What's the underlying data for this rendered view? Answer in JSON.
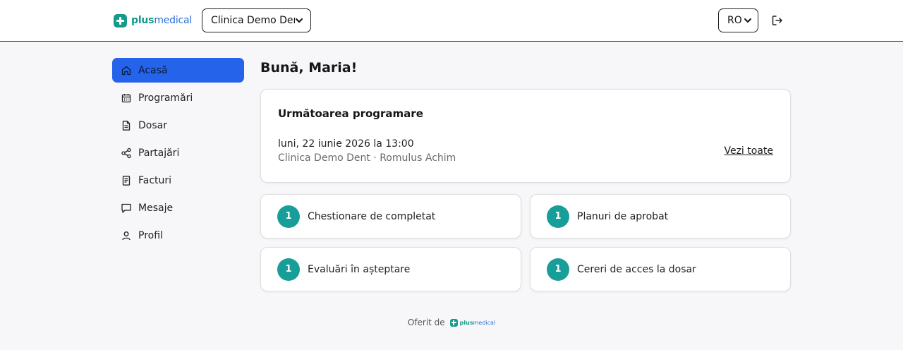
{
  "brand": {
    "word_bold": "plus",
    "word_light": "medical",
    "color_mark": "#159a8c",
    "color_bold": "#159a8c",
    "color_light": "#2b6fd6"
  },
  "header": {
    "clinic_select": "Clinica Demo Dent",
    "language_select": "RO"
  },
  "sidebar": {
    "items": [
      {
        "label": "Acasă",
        "icon": "home-icon",
        "active": true
      },
      {
        "label": "Programări",
        "icon": "calendar-icon",
        "active": false
      },
      {
        "label": "Dosar",
        "icon": "document-icon",
        "active": false
      },
      {
        "label": "Partajări",
        "icon": "share-icon",
        "active": false
      },
      {
        "label": "Facturi",
        "icon": "invoice-icon",
        "active": false
      },
      {
        "label": "Mesaje",
        "icon": "message-icon",
        "active": false
      },
      {
        "label": "Profil",
        "icon": "user-icon",
        "active": false
      }
    ]
  },
  "main": {
    "greeting": "Bună, Maria!",
    "next_appointment": {
      "title": "Următoarea programare",
      "date": "luni, 22 iunie 2026 la 13:00",
      "details": "Clinica Demo Dent · Romulus Achim",
      "see_all": "Vezi toate"
    },
    "tasks": [
      {
        "count": "1",
        "label": "Chestionare de completat"
      },
      {
        "count": "1",
        "label": "Planuri de aprobat"
      },
      {
        "count": "1",
        "label": "Evaluări în așteptare"
      },
      {
        "count": "1",
        "label": "Cereri de acces la dosar"
      }
    ]
  },
  "footer": {
    "offered_by": "Oferit de"
  },
  "colors": {
    "accent": "#2563eb",
    "badge": "#179e98",
    "background": "#f7f7f9"
  }
}
